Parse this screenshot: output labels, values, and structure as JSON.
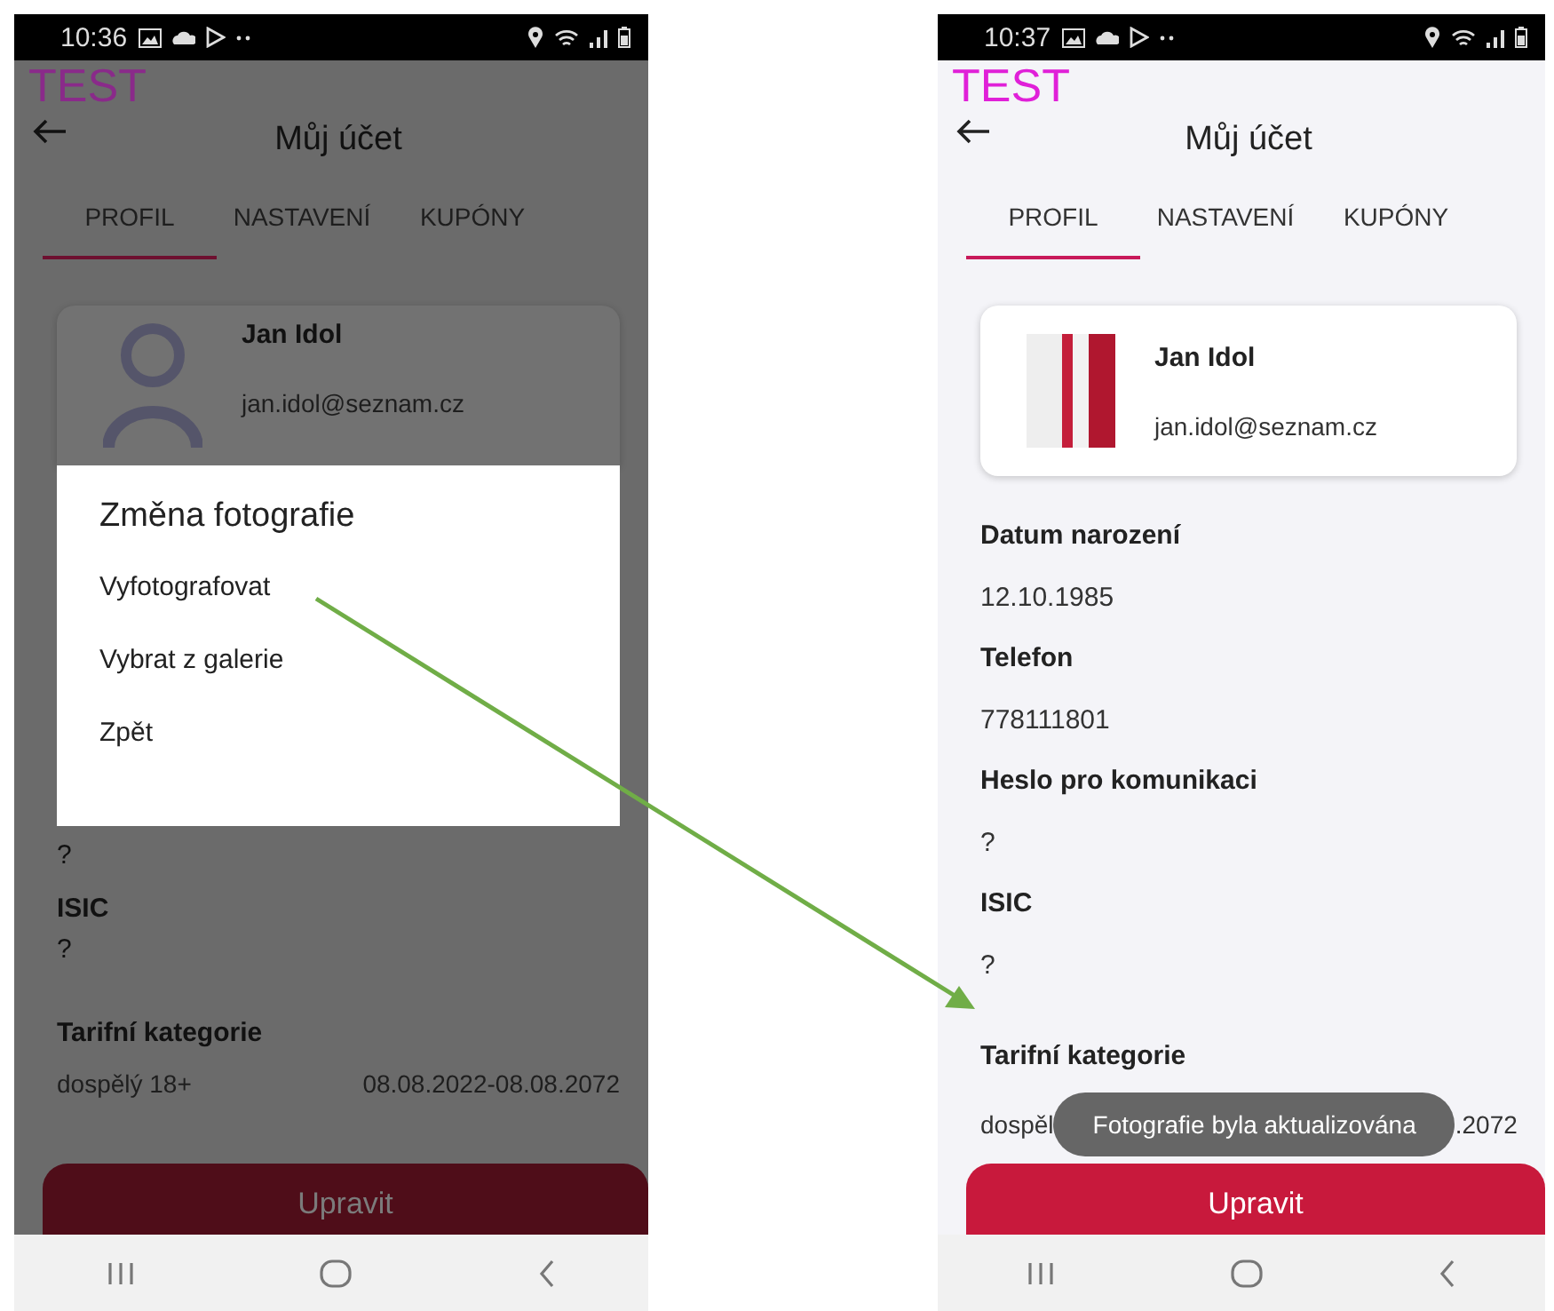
{
  "screens": [
    {
      "dimmed": true,
      "status_time": "10:36",
      "badge": "TEST",
      "title": "Můj účet",
      "tabs": [
        {
          "label": "PROFIL",
          "selected": true
        },
        {
          "label": "NASTAVENÍ",
          "selected": false
        },
        {
          "label": "KUPÓNY",
          "selected": false
        }
      ],
      "profile": {
        "kind": "default",
        "name": "Jan Idol",
        "email": "jan.idol@seznam.cz"
      },
      "dialog": {
        "title": "Změna fotografie",
        "options": [
          "Vyfotografovat",
          "Vybrat z galerie",
          "Zpět"
        ]
      },
      "fields": [
        {
          "value": "?"
        },
        {
          "label": "ISIC",
          "value": "?"
        }
      ],
      "tariff": {
        "label": "Tarifní kategorie",
        "category": "dospělý 18+",
        "validity": "08.08.2022-08.08.2072"
      },
      "button": "Upravit"
    },
    {
      "dimmed": false,
      "status_time": "10:37",
      "badge": "TEST",
      "title": "Můj účet",
      "tabs": [
        {
          "label": "PROFIL",
          "selected": true
        },
        {
          "label": "NASTAVENÍ",
          "selected": false
        },
        {
          "label": "KUPÓNY",
          "selected": false
        }
      ],
      "profile": {
        "kind": "photo",
        "name": "Jan Idol",
        "email": "jan.idol@seznam.cz"
      },
      "fields": [
        {
          "label": "Datum narození",
          "value": "12.10.1985"
        },
        {
          "label": "Telefon",
          "value": "778111801"
        },
        {
          "label": "Heslo pro komunikaci",
          "value": "?"
        },
        {
          "label": "ISIC",
          "value": "?"
        }
      ],
      "tariff": {
        "label": "Tarifní kategorie",
        "category": "dospěl",
        "validity": ".2072"
      },
      "toast": "Fotografie byla aktualizována",
      "button": "Upravit"
    }
  ]
}
